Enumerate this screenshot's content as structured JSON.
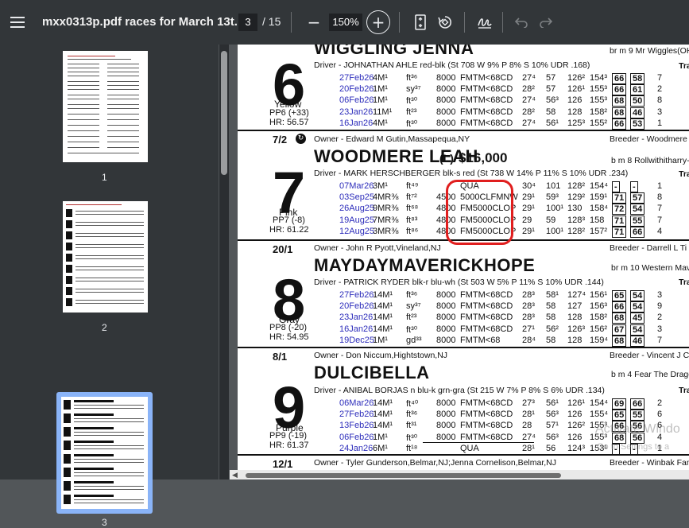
{
  "toolbar": {
    "menu_icon": "menu-icon",
    "title": "mxx0313p.pdf races for March 13t...",
    "current_page": "3",
    "page_total": "/ 15",
    "zoom_out": "−",
    "zoom": "150%",
    "zoom_in": "+",
    "fit_icon": "fit-page-icon",
    "rotate_icon": "rotate-icon",
    "annotate_icon": "draw-icon",
    "undo_icon": "undo-icon",
    "redo_icon": "redo-icon"
  },
  "sidebar": {
    "thumbnails": [
      {
        "label": "1"
      },
      {
        "label": "2"
      },
      {
        "label": "3"
      }
    ]
  },
  "horses": [
    {
      "name": "WIGGLING JENNA",
      "number": "6",
      "color": "Yellow",
      "pp": "PP6 (+33)",
      "hr": "HR: 56.57",
      "breeding": "br m 9 Mr Wiggles(OH)",
      "train": "Trai",
      "driver": "Driver - JOHNATHAN AHLE red-blk (St 708 W 9% P 8% S 10% UDR .168)",
      "races": [
        {
          "date": "27Feb26",
          "race": "4M¹",
          "cond": "ft³⁶",
          "purse": "8000",
          "class": "FMTM<68CD",
          "q1": "27⁴",
          "q2": "57",
          "q3": "126²",
          "fin": "154³",
          "sp": "66",
          "fig": "58",
          "pos": "7"
        },
        {
          "date": "20Feb26",
          "race": "1M¹",
          "cond": "sy³⁷",
          "purse": "8000",
          "class": "FMTM<68CD",
          "q1": "28²",
          "q2": "57",
          "q3": "126¹",
          "fin": "155³",
          "sp": "66",
          "fig": "61",
          "pos": "2"
        },
        {
          "date": "06Feb26",
          "race": "1M¹",
          "cond": "ft³⁰",
          "purse": "8000",
          "class": "FMTM<68CD",
          "q1": "27⁴",
          "q2": "56³",
          "q3": "126",
          "fin": "155³",
          "sp": "68",
          "fig": "50",
          "pos": "8"
        },
        {
          "date": "23Jan26",
          "race": "11M¹",
          "cond": "ft²³",
          "purse": "8000",
          "class": "FMTM<68CD",
          "q1": "28²",
          "q2": "58",
          "q3": "128",
          "fin": "158²",
          "sp": "68",
          "fig": "46",
          "pos": "3"
        },
        {
          "date": "16Jan26",
          "race": "4M¹",
          "cond": "ft³⁰",
          "purse": "8000",
          "class": "FMTM<68CD",
          "q1": "27⁴",
          "q2": "56¹",
          "q3": "125³",
          "fin": "155²",
          "sp": "66",
          "fig": "53",
          "pos": "1"
        }
      ],
      "odds": "7/2",
      "owner": "Owner - Edward M Gutin,Massapequa,NY",
      "breeder": "Breeder - Woodmere"
    },
    {
      "name": "WOODMERE LEAH",
      "suffix": "(L)",
      "claim": "$16,000",
      "number": "7",
      "color": "Pink",
      "pp": "PP7 (-8)",
      "hr": "HR: 61.22",
      "breeding": "b m 8 Rollwithitharry-",
      "train": "Trai",
      "driver": "Driver - MARK HERSCHBERGER blk-s red (St 738 W 14% P 11% S 10% UDR .234)",
      "races": [
        {
          "date": "07Mar26",
          "race": "3M¹",
          "cond": "ft⁴⁹",
          "purse": "",
          "class": "QUA",
          "q1": "30⁴",
          "q2": "101",
          "q3": "128²",
          "fin": "154⁴",
          "sp": "-",
          "fig": "-",
          "pos": "1"
        },
        {
          "date": "03Sep25",
          "race": "4MR⅜",
          "cond": "ft⁷²",
          "purse": "4500",
          "class": "5000CLFMNW",
          "q1": "29¹",
          "q2": "59³",
          "q3": "129²",
          "fin": "159¹",
          "sp": "71",
          "fig": "57",
          "pos": "8"
        },
        {
          "date": "26Aug25",
          "race": "9MR⅜",
          "cond": "ft⁶⁸",
          "purse": "4800",
          "class": "FM5000CLOP",
          "q1": "29¹",
          "q2": "100¹",
          "q3": "130",
          "fin": "158⁴",
          "sp": "72",
          "fig": "54",
          "pos": "7"
        },
        {
          "date": "19Aug25",
          "race": "7MR⅜",
          "cond": "ft⁸³",
          "purse": "4800",
          "class": "FM5000CLOP",
          "q1": "29",
          "q2": "59",
          "q3": "128³",
          "fin": "158",
          "sp": "71",
          "fig": "55",
          "pos": "7"
        },
        {
          "date": "12Aug25",
          "race": "3MR⅜",
          "cond": "ft⁸⁶",
          "purse": "4800",
          "class": "FM5000CLOP",
          "q1": "29¹",
          "q2": "100¹",
          "q3": "128²",
          "fin": "157²",
          "sp": "71",
          "fig": "66",
          "pos": "4"
        }
      ],
      "odds": "20/1",
      "owner": "Owner - John R Pyott,Vineland,NJ",
      "breeder": "Breeder - Darrell L Ti"
    },
    {
      "name": "MAYDAYMAVERICKHOPE",
      "number": "8",
      "color": "Gray",
      "pp": "PP8 (-20)",
      "hr": "HR: 54.95",
      "breeding": "br m 10 Western Mav",
      "train": "Trai",
      "driver": "Driver - PATRICK RYDER blk-r blu-wh (St 503 W 5% P 11% S 10% UDR .144)",
      "races": [
        {
          "date": "27Feb26",
          "race": "14M¹",
          "cond": "ft³⁶",
          "purse": "8000",
          "class": "FMTM<68CD",
          "q1": "28³",
          "q2": "58¹",
          "q3": "127⁴",
          "fin": "156¹",
          "sp": "65",
          "fig": "54",
          "pos": "3"
        },
        {
          "date": "20Feb26",
          "race": "14M¹",
          "cond": "sy³⁷",
          "purse": "8000",
          "class": "FMTM<68CD",
          "q1": "28³",
          "q2": "58",
          "q3": "127",
          "fin": "156³",
          "sp": "66",
          "fig": "54",
          "pos": "9"
        },
        {
          "date": "23Jan26",
          "race": "14M¹",
          "cond": "ft²³",
          "purse": "8000",
          "class": "FMTM<68CD",
          "q1": "28³",
          "q2": "58",
          "q3": "128",
          "fin": "158²",
          "sp": "68",
          "fig": "45",
          "pos": "2"
        },
        {
          "date": "16Jan26",
          "race": "14M¹",
          "cond": "ft³⁰",
          "purse": "8000",
          "class": "FMTM<68CD",
          "q1": "27¹",
          "q2": "56²",
          "q3": "126³",
          "fin": "156²",
          "sp": "67",
          "fig": "54",
          "pos": "3"
        },
        {
          "date": "19Dec25",
          "race": "1M¹",
          "cond": "gd³³",
          "purse": "8000",
          "class": "FMTM<68",
          "q1": "28⁴",
          "q2": "58",
          "q3": "128",
          "fin": "159⁴",
          "sp": "68",
          "fig": "46",
          "pos": "7"
        }
      ],
      "odds": "8/1",
      "owner": "Owner - Don Niccum,Hightstown,NJ",
      "breeder": "Breeder - Vincent J C"
    },
    {
      "name": "DULCIBELLA",
      "number": "9",
      "color": "Purple",
      "pp": "PP9 (-19)",
      "hr": "HR: 61.37",
      "breeding": "b m 4 Fear The Drago",
      "train": "Trai",
      "driver": "Driver - ANIBAL BORJAS n blu-k grn-gra (St 215 W 7% P 8% S 6% UDR .134)",
      "races": [
        {
          "date": "06Mar26",
          "race": "14M¹",
          "cond": "ft⁴⁰",
          "purse": "8000",
          "class": "FMTM<68CD",
          "q1": "27³",
          "q2": "56¹",
          "q3": "126¹",
          "fin": "154⁴",
          "sp": "69",
          "fig": "66",
          "pos": "2"
        },
        {
          "date": "27Feb26",
          "race": "14M¹",
          "cond": "ft³⁶",
          "purse": "8000",
          "class": "FMTM<68CD",
          "q1": "28¹",
          "q2": "56³",
          "q3": "126",
          "fin": "155⁴",
          "sp": "65",
          "fig": "55",
          "pos": "6"
        },
        {
          "date": "13Feb26",
          "race": "14M¹",
          "cond": "ft³¹",
          "purse": "8000",
          "class": "FMTM<68CD",
          "q1": "28",
          "q2": "57¹",
          "q3": "126²",
          "fin": "155³",
          "sp": "66",
          "fig": "56",
          "pos": "6"
        },
        {
          "date": "06Feb26",
          "race": "1M¹",
          "cond": "ft³⁰",
          "purse": "8000",
          "class": "FMTM<68CD",
          "q1": "27⁴",
          "q2": "56³",
          "q3": "126",
          "fin": "155³",
          "sp": "68",
          "fig": "56",
          "pos": "4"
        },
        {
          "date": "24Jan26",
          "race": "6M¹",
          "cond": "ft¹⁸",
          "purse": "",
          "class": "QUA",
          "q1": "28¹",
          "q2": "56",
          "q3": "124³",
          "fin": "153¹",
          "sp": "-",
          "fig": "-",
          "pos": "1"
        }
      ],
      "odds": "12/1",
      "owner": "Owner - Tyler Gunderson,Belmar,NJ;Jenna Cornelison,Belmar,NJ",
      "breeder": "Breeder - Winbak Fam"
    }
  ],
  "watermark": {
    "line1": "Activate Windo",
    "line2": "Go to Settings to a"
  }
}
